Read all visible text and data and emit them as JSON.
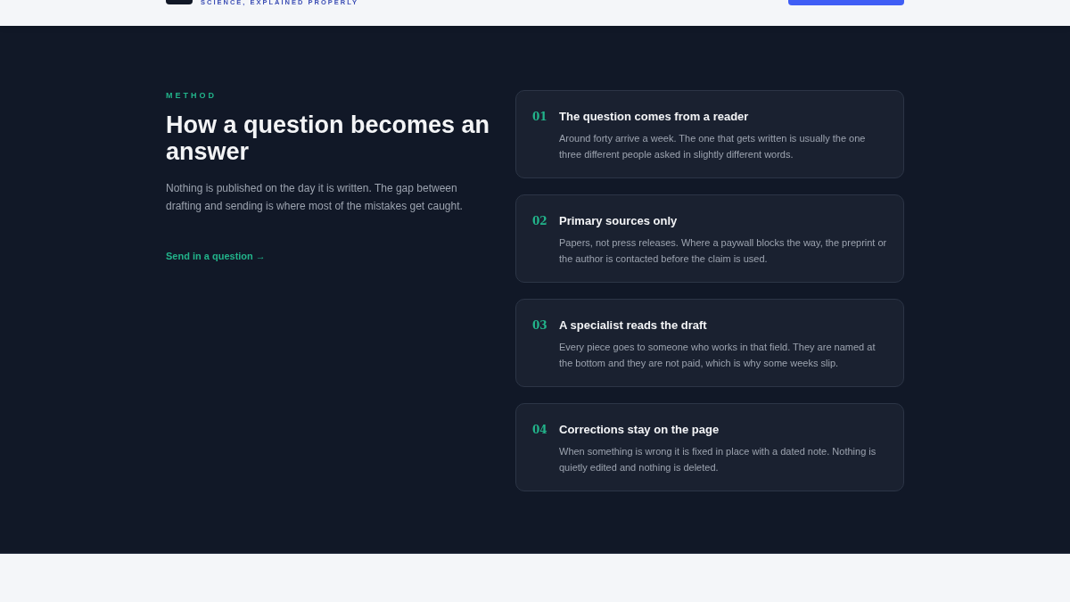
{
  "header": {
    "tagline": "SCIENCE, EXPLAINED PROPERLY"
  },
  "method": {
    "eyebrow": "METHOD",
    "title": "How a question becomes an answer",
    "intro": "Nothing is published on the day it is written. The gap between drafting and sending is where most of the mistakes get caught.",
    "link": "Send in a question",
    "link_arrow": "→"
  },
  "steps": [
    {
      "number": "01",
      "title": "The question comes from a reader",
      "text": "Around forty arrive a week. The one that gets written is usually the one three different people asked in slightly different words."
    },
    {
      "number": "02",
      "title": "Primary sources only",
      "text": "Papers, not press releases. Where a paywall blocks the way, the preprint or the author is contacted before the claim is used."
    },
    {
      "number": "03",
      "title": "A specialist reads the draft",
      "text": "Every piece goes to someone who works in that field. They are named at the bottom and they are not paid, which is why some weeks slip."
    },
    {
      "number": "04",
      "title": "Corrections stay on the page",
      "text": "When something is wrong it is fixed in place with a dated note. Nothing is quietly edited and nothing is deleted."
    }
  ]
}
